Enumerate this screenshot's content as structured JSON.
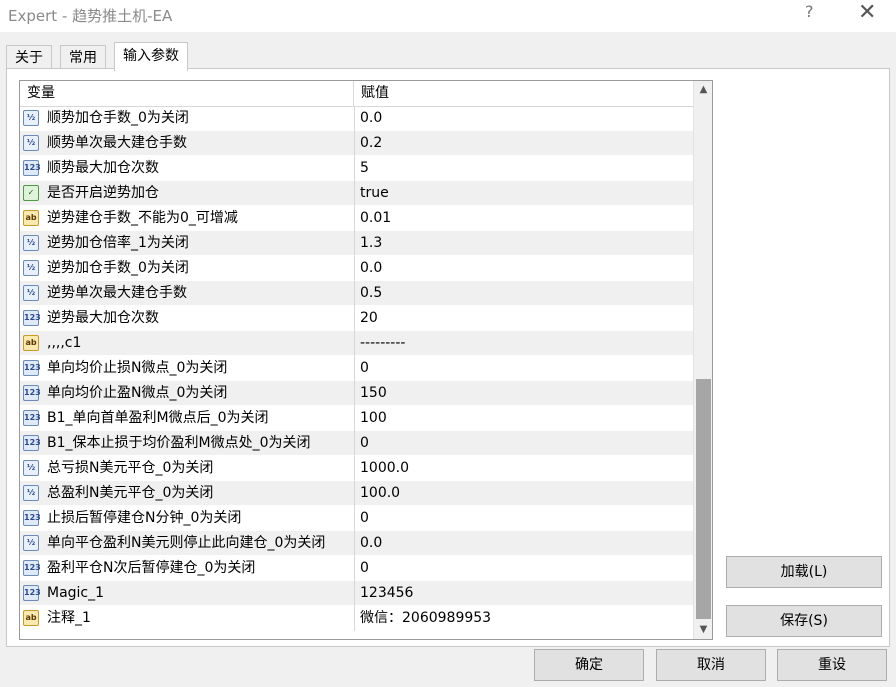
{
  "window": {
    "title": "Expert - 趋势推土机-EA",
    "help_glyph": "?",
    "close_glyph": "✕"
  },
  "tabs": [
    {
      "label": "关于",
      "active": false
    },
    {
      "label": "常用",
      "active": false
    },
    {
      "label": "输入参数",
      "active": true
    }
  ],
  "grid": {
    "headers": {
      "variable": "变量",
      "value": "赋值"
    },
    "rows": [
      {
        "type": "double",
        "icon_text": "½",
        "name": "顺势加仓手数_0为关闭",
        "value": "0.0"
      },
      {
        "type": "double",
        "icon_text": "½",
        "name": "顺势单次最大建仓手数",
        "value": "0.2"
      },
      {
        "type": "int",
        "icon_text": "123",
        "name": "顺势最大加仓次数",
        "value": "5"
      },
      {
        "type": "bool",
        "icon_text": "✓",
        "name": "是否开启逆势加仓",
        "value": "true"
      },
      {
        "type": "string",
        "icon_text": "ab",
        "name": "逆势建仓手数_不能为0_可增减",
        "value": "0.01"
      },
      {
        "type": "double",
        "icon_text": "½",
        "name": "逆势加仓倍率_1为关闭",
        "value": "1.3"
      },
      {
        "type": "double",
        "icon_text": "½",
        "name": "逆势加仓手数_0为关闭",
        "value": "0.0"
      },
      {
        "type": "double",
        "icon_text": "½",
        "name": "逆势单次最大建仓手数",
        "value": "0.5"
      },
      {
        "type": "int",
        "icon_text": "123",
        "name": "逆势最大加仓次数",
        "value": "20"
      },
      {
        "type": "string",
        "icon_text": "ab",
        "name": ",,,,c1",
        "value": "---------"
      },
      {
        "type": "int",
        "icon_text": "123",
        "name": "单向均价止损N微点_0为关闭",
        "value": "0"
      },
      {
        "type": "int",
        "icon_text": "123",
        "name": "单向均价止盈N微点_0为关闭",
        "value": "150"
      },
      {
        "type": "int",
        "icon_text": "123",
        "name": "B1_单向首单盈利M微点后_0为关闭",
        "value": "100"
      },
      {
        "type": "int",
        "icon_text": "123",
        "name": "B1_保本止损于均价盈利M微点处_0为关闭",
        "value": "0"
      },
      {
        "type": "double",
        "icon_text": "½",
        "name": "总亏损N美元平仓_0为关闭",
        "value": "1000.0"
      },
      {
        "type": "double",
        "icon_text": "½",
        "name": "总盈利N美元平仓_0为关闭",
        "value": "100.0"
      },
      {
        "type": "int",
        "icon_text": "123",
        "name": "止损后暂停建仓N分钟_0为关闭",
        "value": "0"
      },
      {
        "type": "double",
        "icon_text": "½",
        "name": "单向平仓盈利N美元则停止此向建仓_0为关闭",
        "value": "0.0"
      },
      {
        "type": "int",
        "icon_text": "123",
        "name": "盈利平仓N次后暂停建仓_0为关闭",
        "value": "0"
      },
      {
        "type": "int",
        "icon_text": "123",
        "name": "Magic_1",
        "value": "123456"
      },
      {
        "type": "string",
        "icon_text": "ab",
        "name": "注释_1",
        "value": "微信：2060989953"
      }
    ],
    "scroll": {
      "up_glyph": "▲",
      "down_glyph": "▼"
    }
  },
  "side_buttons": {
    "load": "加载(L)",
    "save": "保存(S)"
  },
  "footer_buttons": {
    "ok": "确定",
    "cancel": "取消",
    "reset": "重设"
  }
}
